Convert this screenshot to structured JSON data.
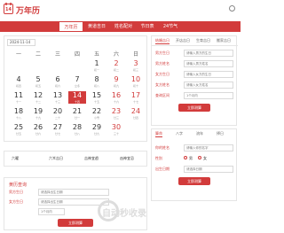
{
  "header": {
    "logo_text": "14",
    "title": "万年历"
  },
  "nav": {
    "items": [
      "万年历",
      "黄道吉日",
      "姓名配对",
      "节日表",
      "24节气"
    ]
  },
  "calendar": {
    "date_value": "2024-11-14",
    "weekdays": [
      "一",
      "二",
      "三",
      "四",
      "五",
      "六",
      "日"
    ],
    "days": [
      {
        "n": "",
        "l": ""
      },
      {
        "n": "",
        "l": ""
      },
      {
        "n": "",
        "l": ""
      },
      {
        "n": "",
        "l": ""
      },
      {
        "n": "1",
        "l": "初一"
      },
      {
        "n": "2",
        "l": "初二"
      },
      {
        "n": "3",
        "l": "初三"
      },
      {
        "n": "4",
        "l": "初四"
      },
      {
        "n": "5",
        "l": "初五"
      },
      {
        "n": "6",
        "l": "初六"
      },
      {
        "n": "7",
        "l": "立冬"
      },
      {
        "n": "8",
        "l": "初八"
      },
      {
        "n": "9",
        "l": "初九"
      },
      {
        "n": "10",
        "l": "初十"
      },
      {
        "n": "11",
        "l": "十一"
      },
      {
        "n": "12",
        "l": "十二"
      },
      {
        "n": "13",
        "l": "十三"
      },
      {
        "n": "14",
        "l": "十四"
      },
      {
        "n": "15",
        "l": "十五"
      },
      {
        "n": "16",
        "l": "十六"
      },
      {
        "n": "17",
        "l": "十七"
      },
      {
        "n": "18",
        "l": "十八"
      },
      {
        "n": "19",
        "l": "十九"
      },
      {
        "n": "20",
        "l": "二十"
      },
      {
        "n": "21",
        "l": "廿一"
      },
      {
        "n": "22",
        "l": "小雪"
      },
      {
        "n": "23",
        "l": "廿三"
      },
      {
        "n": "24",
        "l": "廿四"
      },
      {
        "n": "25",
        "l": "廿五"
      },
      {
        "n": "26",
        "l": "廿六"
      },
      {
        "n": "27",
        "l": "廿七"
      },
      {
        "n": "28",
        "l": "廿八"
      },
      {
        "n": "29",
        "l": "廿九"
      },
      {
        "n": "30",
        "l": "三十"
      },
      {
        "n": "",
        "l": ""
      }
    ]
  },
  "info_bar": {
    "items": [
      "六曜",
      "六爻吉日",
      "吉神宜趋",
      "凶神宜忌"
    ]
  },
  "right_panel": {
    "tabs": [
      "结婚吉日",
      "开店吉日",
      "生育吉日",
      "搬家吉日"
    ],
    "rows": [
      {
        "label": "男方生日",
        "placeholder": "请输入男方的生日"
      },
      {
        "label": "男方姓名",
        "placeholder": "请输入男方姓名"
      },
      {
        "label": "女方生日",
        "placeholder": "请输入女方的生日"
      },
      {
        "label": "女方姓名",
        "placeholder": "请输入女方姓名"
      }
    ],
    "period_label": "查询区间",
    "period_value": "1个月内",
    "button": "立即测算"
  },
  "right_panel2": {
    "tabs": [
      "算命",
      "八字",
      "流年",
      "择日"
    ],
    "name_label": "你的姓名",
    "name_placeholder": "请输入你的名字",
    "gender_label": "性别",
    "gender_options": [
      "男",
      "女"
    ],
    "birth_label": "出生日期",
    "birth_value": "请选择日期",
    "button": "立即测算"
  },
  "bottom_panel": {
    "title": "黄历查询",
    "rows": [
      {
        "label": "男方生日",
        "placeholder": "请选择出生日期"
      },
      {
        "label": "女方生日",
        "placeholder": "请选择出生日期"
      }
    ],
    "option": "1个月内",
    "button": "立即测算"
  },
  "watermark": "自动秒收录"
}
